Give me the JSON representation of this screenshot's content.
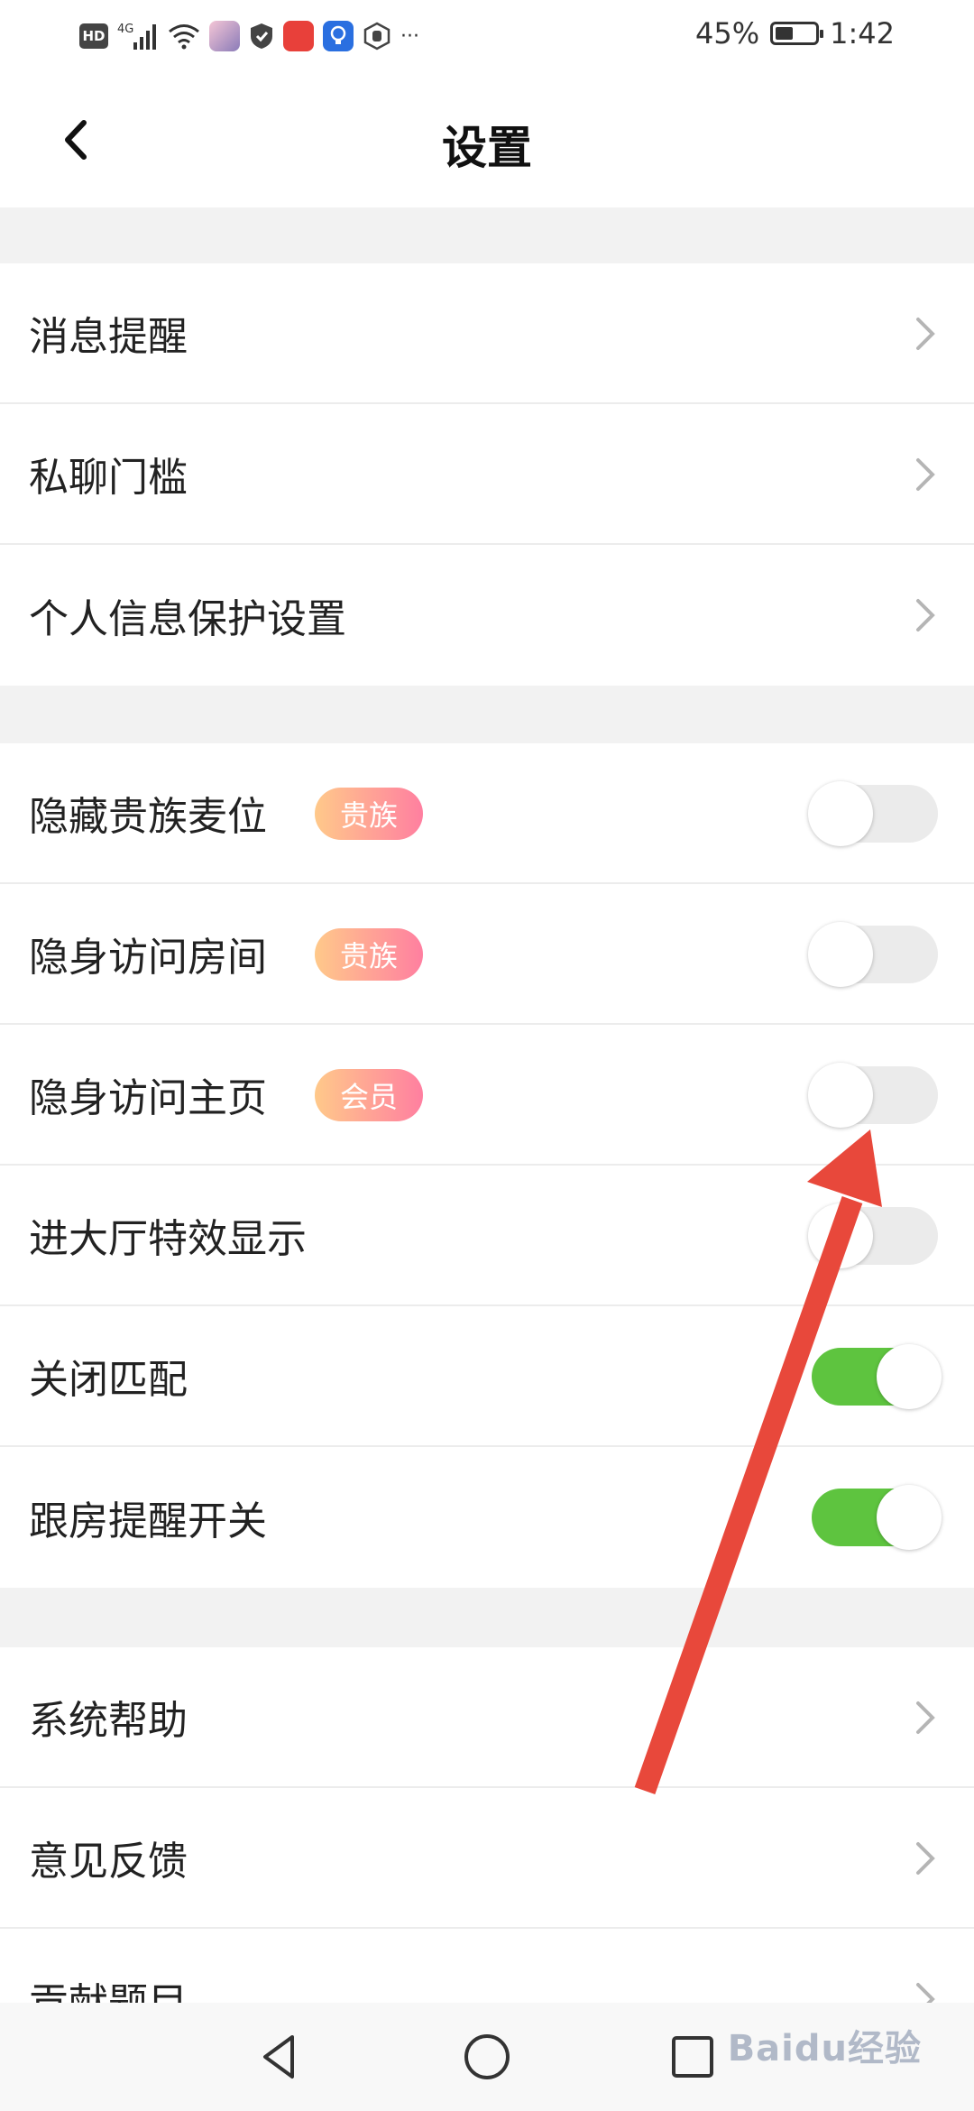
{
  "status_bar": {
    "hd": "HD",
    "network": "4G",
    "more": "···",
    "battery_text": "45%",
    "battery_level": 0.45,
    "time": "1:42"
  },
  "header": {
    "title": "设置",
    "back_icon": "chevron-left-icon"
  },
  "groups": {
    "g1": [
      {
        "label": "消息提醒",
        "icon": "chevron-right-icon"
      },
      {
        "label": "私聊门槛",
        "icon": "chevron-right-icon"
      },
      {
        "label": "个人信息保护设置",
        "icon": "chevron-right-icon"
      }
    ],
    "g2": [
      {
        "label": "隐藏贵族麦位",
        "badge": "贵族",
        "toggle": false
      },
      {
        "label": "隐身访问房间",
        "badge": "贵族",
        "toggle": false
      },
      {
        "label": "隐身访问主页",
        "badge": "会员",
        "toggle": false
      },
      {
        "label": "进大厅特效显示",
        "toggle": false
      },
      {
        "label": "关闭匹配",
        "toggle": true
      },
      {
        "label": "跟房提醒开关",
        "toggle": true
      }
    ],
    "g3": [
      {
        "label": "系统帮助",
        "icon": "chevron-right-icon"
      },
      {
        "label": "意见反馈",
        "icon": "chevron-right-icon"
      },
      {
        "label": "贡献题目",
        "icon": "chevron-right-icon"
      }
    ]
  },
  "colors": {
    "toggle_on": "#5ec43f",
    "toggle_off": "#ebebeb",
    "badge_gradient": [
      "#ffc98a",
      "#ff7fa0"
    ],
    "annotation_arrow": "#e8483b"
  },
  "watermark": "Baidu经验"
}
